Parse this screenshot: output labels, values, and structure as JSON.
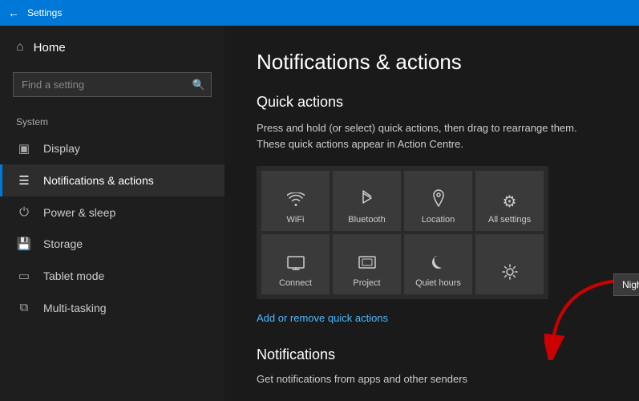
{
  "titleBar": {
    "title": "Settings",
    "backIcon": "←"
  },
  "sidebar": {
    "homeLabel": "Home",
    "homeIcon": "⊙",
    "searchPlaceholder": "Find a setting",
    "searchIcon": "🔍",
    "sectionLabel": "System",
    "items": [
      {
        "id": "display",
        "label": "Display",
        "icon": "🖥"
      },
      {
        "id": "notifications",
        "label": "Notifications & actions",
        "icon": "💬",
        "active": true
      },
      {
        "id": "power",
        "label": "Power & sleep",
        "icon": "⏻"
      },
      {
        "id": "storage",
        "label": "Storage",
        "icon": "💾"
      },
      {
        "id": "tablet",
        "label": "Tablet mode",
        "icon": "⬛"
      },
      {
        "id": "multitasking",
        "label": "Multi-tasking",
        "icon": "⧉"
      }
    ]
  },
  "content": {
    "pageTitle": "Notifications & actions",
    "quickActions": {
      "sectionTitle": "Quick actions",
      "description": "Press and hold (or select) quick actions, then drag to rearrange them. These quick actions appear in Action Centre.",
      "tiles": [
        {
          "id": "wifi",
          "label": "WiFi",
          "icon": "wifi"
        },
        {
          "id": "bluetooth",
          "label": "Bluetooth",
          "icon": "bluetooth"
        },
        {
          "id": "location",
          "label": "Location",
          "icon": "location"
        },
        {
          "id": "allsettings",
          "label": "All settings",
          "icon": "gear"
        },
        {
          "id": "connect",
          "label": "Connect",
          "icon": "connect"
        },
        {
          "id": "project",
          "label": "Project",
          "icon": "project"
        },
        {
          "id": "quiethours",
          "label": "Quiet hours",
          "icon": "quiet"
        },
        {
          "id": "nightlight",
          "label": "",
          "icon": "nightlight"
        }
      ],
      "tooltip": "Night light",
      "addRemoveLink": "Add or remove quick actions"
    },
    "notifications": {
      "sectionTitle": "Notifications",
      "description": "Get notifications from apps and other senders"
    }
  }
}
